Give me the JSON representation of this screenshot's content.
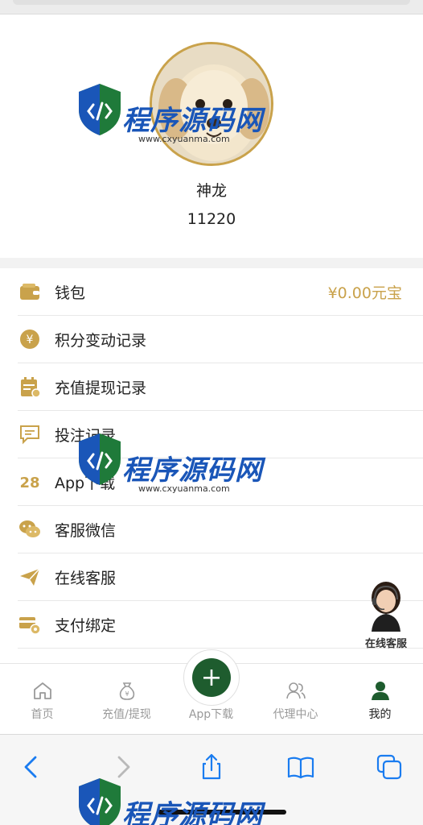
{
  "profile": {
    "username": "神龙",
    "user_id": "11220"
  },
  "menu": {
    "items": [
      {
        "label": "钱包",
        "value": "¥0.00元宝",
        "icon": "wallet-icon"
      },
      {
        "label": "积分变动记录",
        "icon": "yen-coin-icon"
      },
      {
        "label": "充值提现记录",
        "icon": "calendar-record-icon"
      },
      {
        "label": "投注记录",
        "icon": "message-box-icon"
      },
      {
        "label": "App下载",
        "icon": "number-28-icon",
        "icon_text": "28"
      },
      {
        "label": "客服微信",
        "icon": "wechat-icon"
      },
      {
        "label": "在线客服",
        "icon": "paper-plane-icon"
      },
      {
        "label": "支付绑定",
        "icon": "card-gear-icon"
      }
    ]
  },
  "float_service": {
    "label": "在线客服"
  },
  "tabbar": {
    "tabs": [
      {
        "label": "首页",
        "icon": "home-icon"
      },
      {
        "label": "充值/提现",
        "icon": "money-bag-icon"
      },
      {
        "label": "App下载",
        "icon": "plus-icon"
      },
      {
        "label": "代理中心",
        "icon": "users-icon"
      },
      {
        "label": "我的",
        "icon": "person-icon"
      }
    ],
    "active": "我的"
  },
  "watermark": {
    "text": "程序源码网",
    "url": "www.cxyuanma.com"
  },
  "colors": {
    "accent": "#c9a24b",
    "green": "#1e5c2e",
    "ios_blue": "#1a7cf0"
  }
}
